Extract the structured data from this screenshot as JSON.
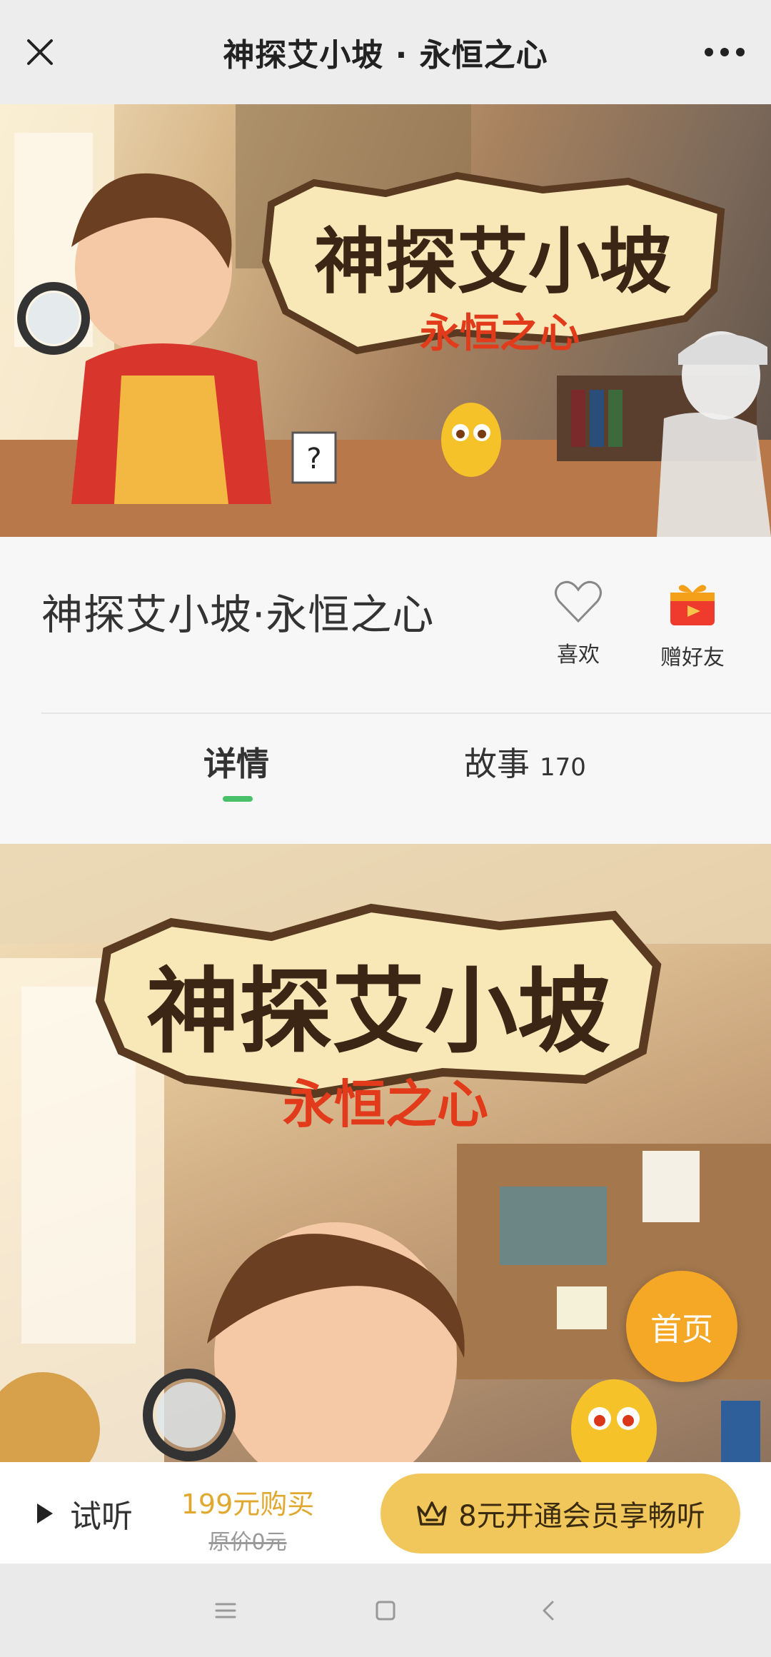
{
  "topbar": {
    "title": "神探艾小坡 · 永恒之心",
    "close_icon": "close-icon",
    "more_icon": "more-icon"
  },
  "hero": {
    "logo_main": "神探艾小坡",
    "logo_sub": "永恒之心"
  },
  "info": {
    "name": "神探艾小坡·永恒之心",
    "like_label": "喜欢",
    "gift_label": "赠好友"
  },
  "tabs": {
    "detail": "详情",
    "story": "故事",
    "story_count": "170"
  },
  "content": {
    "logo_main": "神探艾小坡",
    "logo_sub": "永恒之心"
  },
  "home_button": "首页",
  "buybar": {
    "trial_label": "试听",
    "price_now": "199元购买",
    "price_orig": "原价0元",
    "vip_label": "8元开通会员享畅听"
  },
  "colors": {
    "accent_green": "#49c16b",
    "home_orange": "#f5a826",
    "vip_gold": "#f1c75b",
    "price_gold": "#e0a82e"
  }
}
